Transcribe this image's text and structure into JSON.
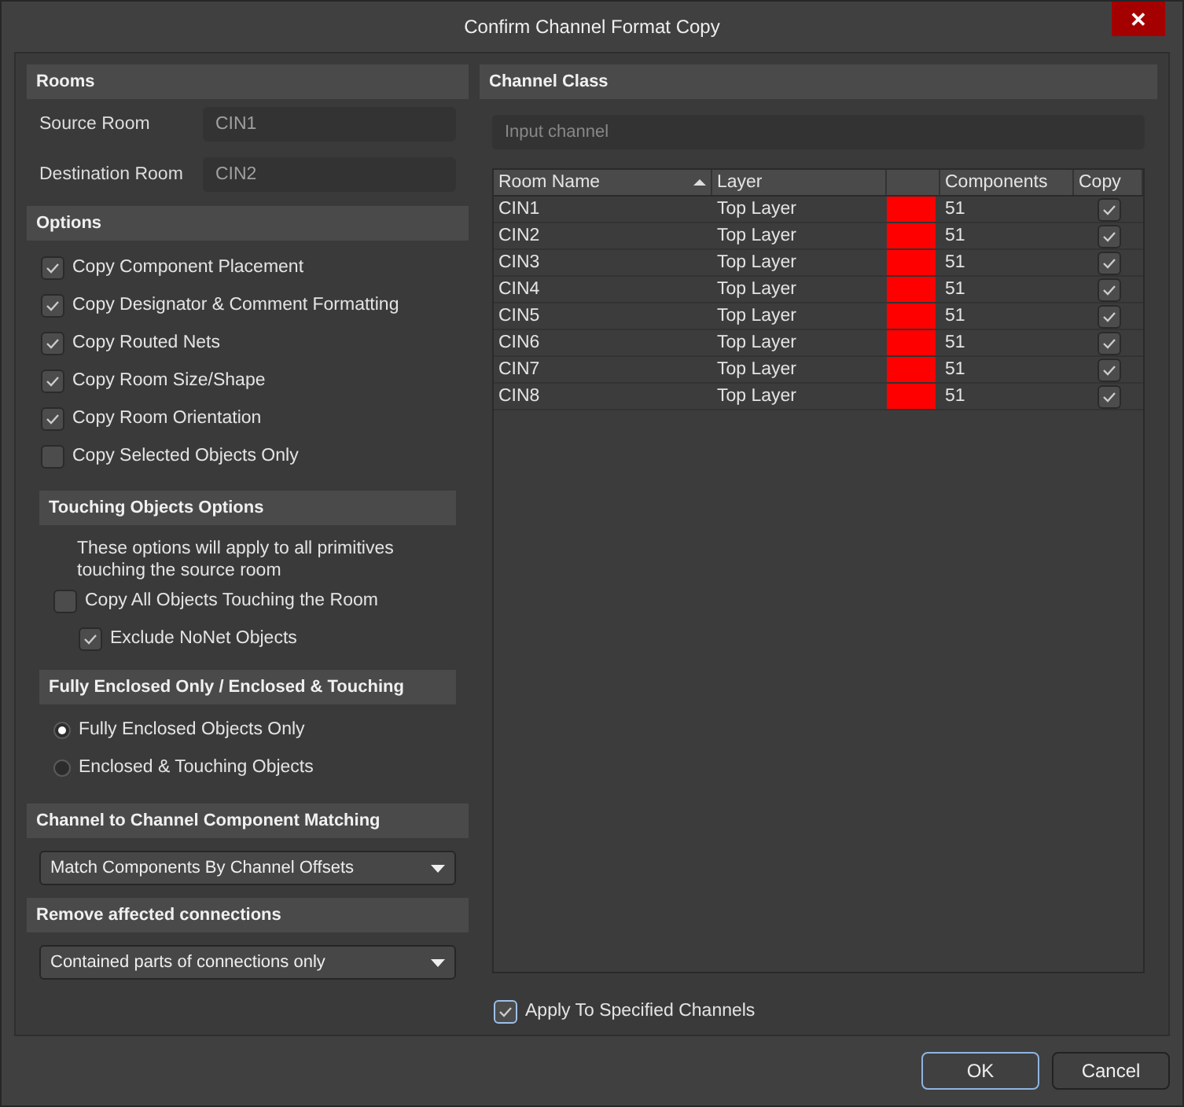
{
  "window": {
    "title": "Confirm Channel Format Copy",
    "close": "✕"
  },
  "rooms": {
    "heading": "Rooms",
    "fields": [
      {
        "label": "Source Room",
        "value": "CIN1"
      },
      {
        "label": "Destination Room",
        "value": "CIN2"
      }
    ]
  },
  "options": {
    "heading": "Options",
    "items": [
      {
        "label": "Copy Component Placement",
        "checked": true
      },
      {
        "label": "Copy Designator & Comment Formatting",
        "checked": true
      },
      {
        "label": "Copy Routed Nets",
        "checked": true
      },
      {
        "label": "Copy Room Size/Shape",
        "checked": true
      },
      {
        "label": "Copy Room Orientation",
        "checked": true
      },
      {
        "label": "Copy Selected Objects Only",
        "checked": false
      }
    ]
  },
  "touching": {
    "heading": "Touching Objects Options",
    "note": "These options will apply to all primitives touching the source room",
    "copy_all": {
      "label": "Copy All Objects Touching the Room",
      "checked": false
    },
    "exclude": {
      "label": "Exclude NoNet Objects",
      "checked": true
    }
  },
  "enclosure": {
    "heading": "Fully Enclosed Only / Enclosed & Touching",
    "choices": [
      {
        "label": "Fully Enclosed Objects Only",
        "selected": true
      },
      {
        "label": "Enclosed & Touching Objects",
        "selected": false
      }
    ]
  },
  "matching": {
    "heading": "Channel to Channel Component Matching",
    "value": "Match Components By Channel Offsets"
  },
  "connections": {
    "heading": "Remove affected connections",
    "value": "Contained parts of connections only"
  },
  "channel_class": {
    "heading": "Channel Class",
    "placeholder": "Input channel"
  },
  "table": {
    "columns": [
      "Room Name",
      "Layer",
      "Components",
      "Copy"
    ],
    "rows": [
      {
        "room": "CIN1",
        "layer": "Top Layer",
        "color": "#ff0000",
        "components": "51",
        "copy": true
      },
      {
        "room": "CIN2",
        "layer": "Top Layer",
        "color": "#ff0000",
        "components": "51",
        "copy": true
      },
      {
        "room": "CIN3",
        "layer": "Top Layer",
        "color": "#ff0000",
        "components": "51",
        "copy": true
      },
      {
        "room": "CIN4",
        "layer": "Top Layer",
        "color": "#ff0000",
        "components": "51",
        "copy": true
      },
      {
        "room": "CIN5",
        "layer": "Top Layer",
        "color": "#ff0000",
        "components": "51",
        "copy": true
      },
      {
        "room": "CIN6",
        "layer": "Top Layer",
        "color": "#ff0000",
        "components": "51",
        "copy": true
      },
      {
        "room": "CIN7",
        "layer": "Top Layer",
        "color": "#ff0000",
        "components": "51",
        "copy": true
      },
      {
        "room": "CIN8",
        "layer": "Top Layer",
        "color": "#ff0000",
        "components": "51",
        "copy": true
      }
    ]
  },
  "apply": {
    "label": "Apply To Specified Channels",
    "checked": true
  },
  "buttons": [
    "OK",
    "Cancel"
  ]
}
